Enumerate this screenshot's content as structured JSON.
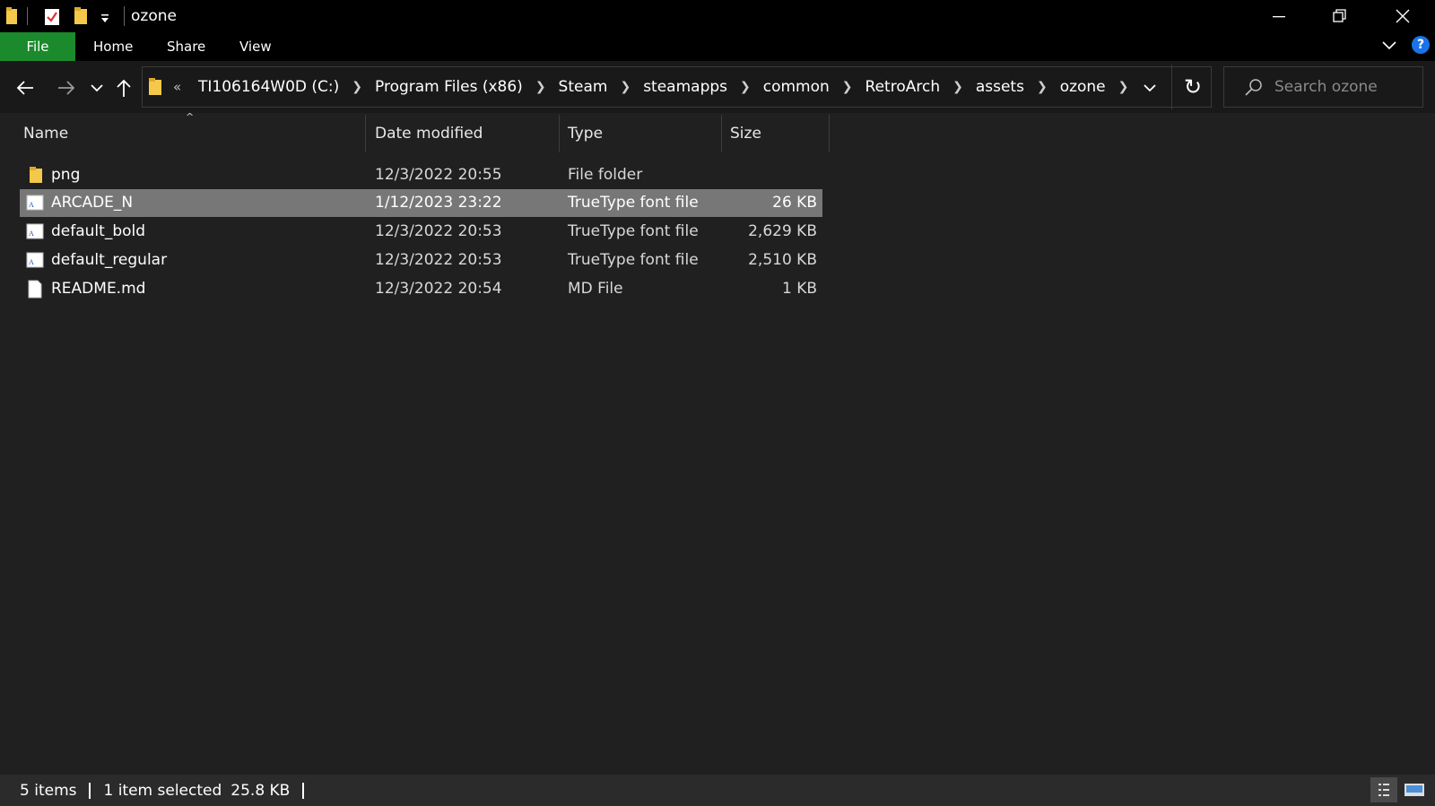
{
  "window": {
    "title": "ozone",
    "controls": {
      "minimize": "minimize-icon",
      "restore": "restore-icon",
      "close": "close-icon"
    }
  },
  "ribbon": {
    "tabs": [
      "File",
      "Home",
      "Share",
      "View"
    ],
    "active_color": "#1b8a2c"
  },
  "address": {
    "overflow": "«",
    "crumbs": [
      "TI106164W0D (C:)",
      "Program Files (x86)",
      "Steam",
      "steamapps",
      "common",
      "RetroArch",
      "assets",
      "ozone"
    ]
  },
  "search": {
    "placeholder": "Search ozone",
    "value": ""
  },
  "columns": {
    "name": "Name",
    "date": "Date modified",
    "type": "Type",
    "size": "Size",
    "sort_indicator": "^"
  },
  "files": [
    {
      "name": "png",
      "date": "12/3/2022 20:55",
      "type": "File folder",
      "size": "",
      "icon": "folder-icon",
      "selected": false
    },
    {
      "name": "ARCADE_N",
      "date": "1/12/2023 23:22",
      "type": "TrueType font file",
      "size": "26 KB",
      "icon": "font-file-icon",
      "selected": true
    },
    {
      "name": "default_bold",
      "date": "12/3/2022 20:53",
      "type": "TrueType font file",
      "size": "2,629 KB",
      "icon": "font-file-icon",
      "selected": false
    },
    {
      "name": "default_regular",
      "date": "12/3/2022 20:53",
      "type": "TrueType font file",
      "size": "2,510 KB",
      "icon": "font-file-icon",
      "selected": false
    },
    {
      "name": "README.md",
      "date": "12/3/2022 20:54",
      "type": "MD File",
      "size": "1 KB",
      "icon": "document-icon",
      "selected": false
    }
  ],
  "status": {
    "items": "5 items",
    "selected": "1 item selected",
    "size": "25.8 KB"
  },
  "colors": {
    "background": "#202020",
    "selection": "#777777",
    "titlebar": "#000000",
    "help": "#1a73e8"
  }
}
